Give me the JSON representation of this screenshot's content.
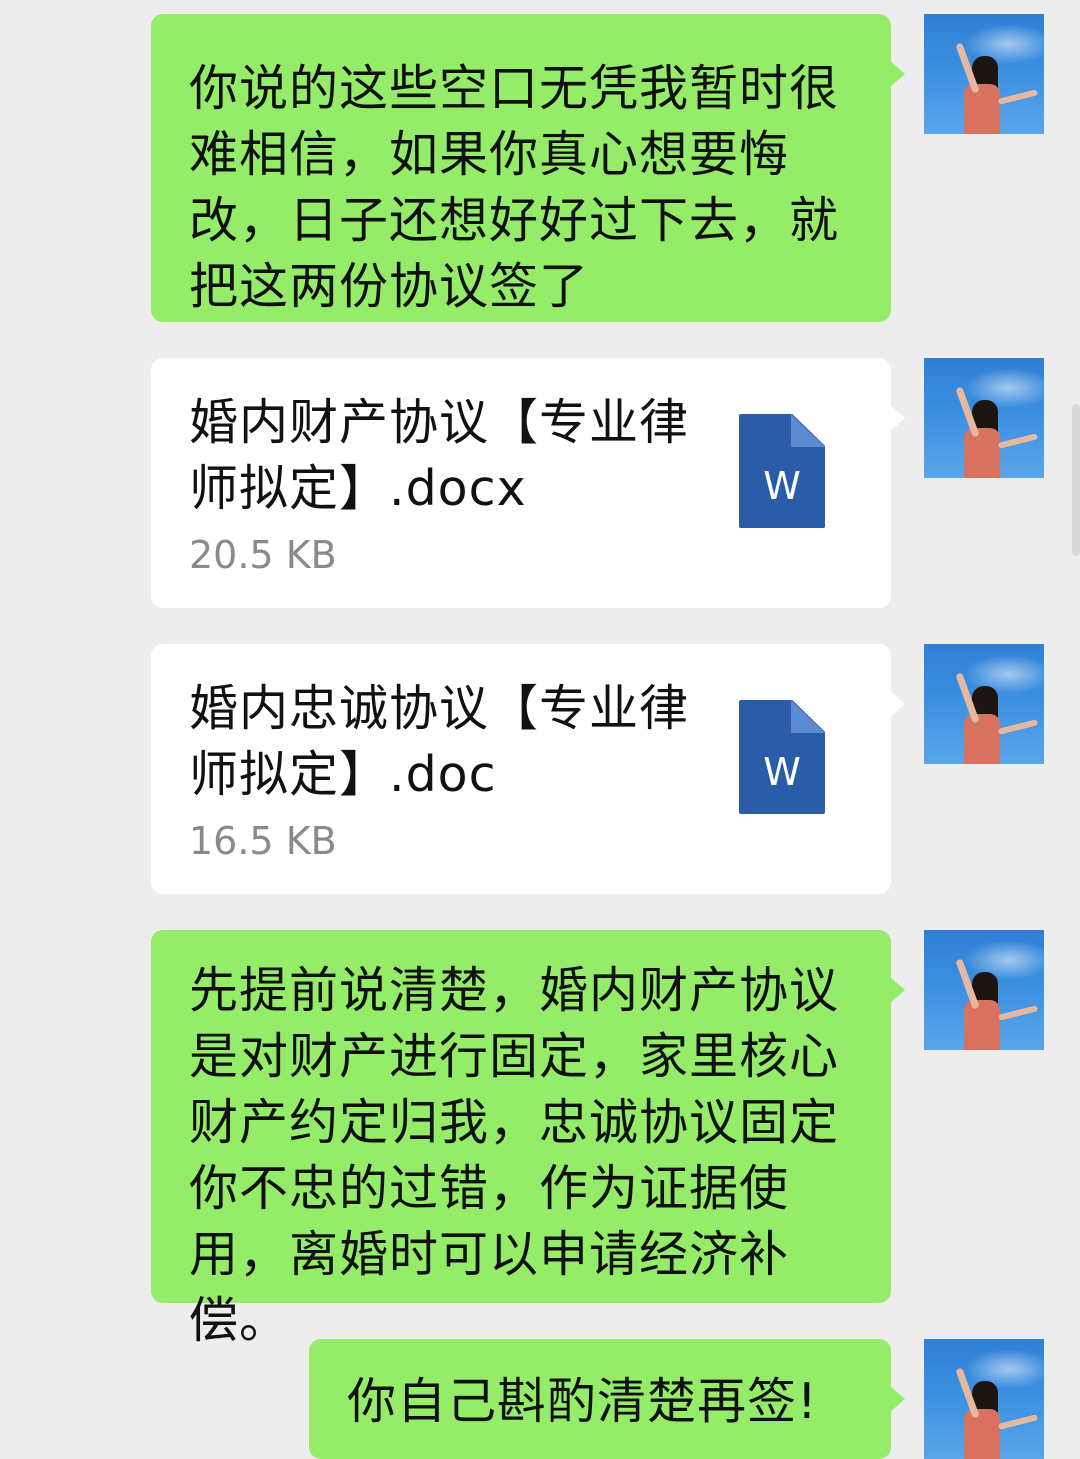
{
  "messages": [
    {
      "type": "text",
      "text": "你说的这些空口无凭我暂时很难相信，如果你真心想要悔改，日子还想好好过下去，就把这两份协议签了"
    },
    {
      "type": "file",
      "file_name": "婚内财产协议【专业律师拟定】.docx",
      "file_size": "20.5 KB",
      "icon_letter": "W"
    },
    {
      "type": "file",
      "file_name": "婚内忠诚协议【专业律师拟定】.doc",
      "file_size": "16.5 KB",
      "icon_letter": "W"
    },
    {
      "type": "text",
      "text": "先提前说清楚，婚内财产协议是对财产进行固定，家里核心财产约定归我，忠诚协议固定你不忠的过错，作为证据使用，离婚时可以申请经济补偿。"
    },
    {
      "type": "text",
      "text": "你自己斟酌清楚再签!"
    }
  ],
  "colors": {
    "background": "#ededed",
    "sent_bubble": "#95ec69",
    "file_bubble": "#ffffff",
    "word_icon": "#2b5ca8",
    "file_size_text": "#8a8a8a"
  },
  "icons": {
    "file_icon": "word-document-icon",
    "avatar": "user-avatar"
  }
}
